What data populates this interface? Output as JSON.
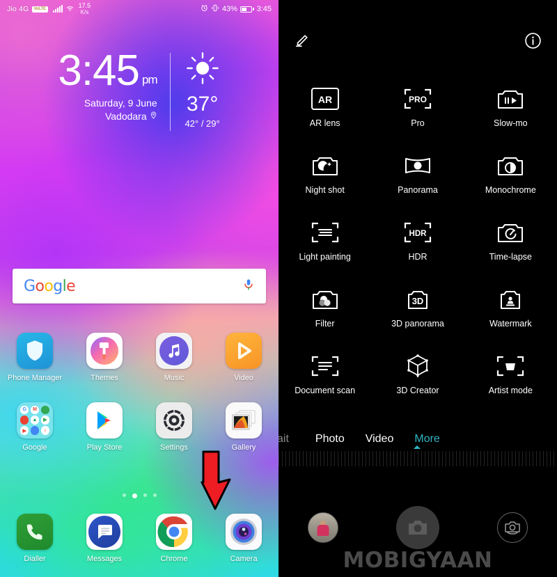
{
  "home": {
    "statusbar": {
      "carrier": "Jio 4G",
      "volte_badge": "VoLTE",
      "net_speed_value": "17.5",
      "net_speed_unit": "K/s",
      "battery_percent": "43%",
      "time": "3:45",
      "alarm_icon": "alarm-icon",
      "vibrate_icon": "vibrate-icon",
      "wifi_icon": "wifi-icon",
      "signal_icon": "signal-bars-icon"
    },
    "widget": {
      "time": "3:45",
      "meridiem": "pm",
      "date": "Saturday, 9 June",
      "location": "Vadodara",
      "location_icon": "location-pin-icon",
      "weather_icon": "sun-icon",
      "temperature": "37°",
      "temp_range": "42° / 29°"
    },
    "search": {
      "logo": "Google",
      "logo_letters": [
        "G",
        "o",
        "o",
        "g",
        "l",
        "e"
      ],
      "mic_icon": "microphone-icon"
    },
    "rows": [
      {
        "apps": [
          {
            "label": "Phone Manager",
            "icon": "phone-manager-icon"
          },
          {
            "label": "Themes",
            "icon": "themes-icon"
          },
          {
            "label": "Music",
            "icon": "music-icon"
          },
          {
            "label": "Video",
            "icon": "video-icon"
          }
        ]
      },
      {
        "apps": [
          {
            "label": "Google",
            "icon": "google-folder-icon"
          },
          {
            "label": "Play Store",
            "icon": "play-store-icon"
          },
          {
            "label": "Settings",
            "icon": "settings-gear-icon"
          },
          {
            "label": "Gallery",
            "icon": "gallery-icon"
          }
        ]
      }
    ],
    "dock": {
      "apps": [
        {
          "label": "Dialler",
          "icon": "phone-handset-icon"
        },
        {
          "label": "Messages",
          "icon": "message-bubble-icon"
        },
        {
          "label": "Chrome",
          "icon": "chrome-icon"
        },
        {
          "label": "Camera",
          "icon": "camera-lens-icon"
        }
      ]
    },
    "page_dots": {
      "count": 4,
      "active_index": 1
    },
    "annotation_arrow": {
      "name": "red-arrow-to-camera",
      "color": "#ee1c23",
      "direction": "down-right"
    }
  },
  "camera": {
    "topbar": {
      "edit_icon": "pencil-edit-icon",
      "info_icon": "info-circle-icon"
    },
    "modes": [
      {
        "label": "AR lens",
        "icon": "ar-lens-icon"
      },
      {
        "label": "Pro",
        "icon": "pro-mode-icon"
      },
      {
        "label": "Slow-mo",
        "icon": "slow-motion-icon"
      },
      {
        "label": "Night shot",
        "icon": "night-shot-icon"
      },
      {
        "label": "Panorama",
        "icon": "panorama-icon"
      },
      {
        "label": "Monochrome",
        "icon": "monochrome-icon"
      },
      {
        "label": "Light painting",
        "icon": "light-painting-icon"
      },
      {
        "label": "HDR",
        "icon": "hdr-icon"
      },
      {
        "label": "Time-lapse",
        "icon": "time-lapse-icon"
      },
      {
        "label": "Filter",
        "icon": "filter-icon"
      },
      {
        "label": "3D panorama",
        "icon": "three-d-panorama-icon"
      },
      {
        "label": "Watermark",
        "icon": "watermark-stamp-icon"
      },
      {
        "label": "Document scan",
        "icon": "document-scan-icon"
      },
      {
        "label": "3D Creator",
        "icon": "three-d-creator-icon"
      },
      {
        "label": "Artist mode",
        "icon": "artist-mode-icon"
      }
    ],
    "annotation_arrow": {
      "name": "red-arrow-to-filter",
      "color": "#ee1c23",
      "direction": "left"
    },
    "tabs": [
      {
        "label": "ait",
        "state": "cut-off"
      },
      {
        "label": "Photo",
        "state": "inactive"
      },
      {
        "label": "Video",
        "state": "inactive"
      },
      {
        "label": "More",
        "state": "active"
      }
    ],
    "active_tab_color": "#2fb5c4",
    "bottom": {
      "gallery_thumb": "gallery-thumbnail",
      "shutter": "shutter-button",
      "switch_camera": "switch-camera-icon"
    },
    "watermark": {
      "text_a": "M",
      "text_b": "BIGYAAN",
      "full": "MOBIGYAAN"
    }
  }
}
